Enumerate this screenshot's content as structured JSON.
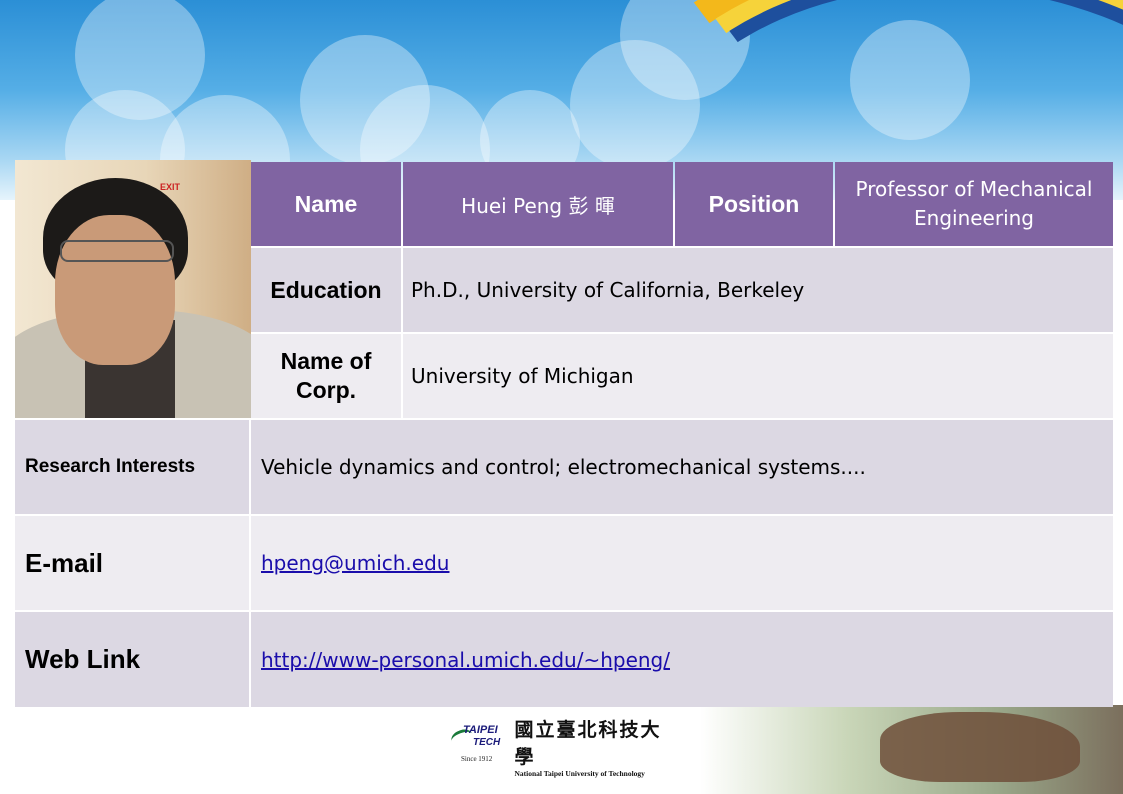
{
  "profile": {
    "name_label": "Name",
    "name_value": "Huei Peng 彭 暉",
    "position_label": "Position",
    "position_value": "Professor of Mechanical Engineering",
    "education_label": "Education",
    "education_value": "Ph.D., University of California, Berkeley",
    "corp_label": "Name of Corp.",
    "corp_value": "University of Michigan",
    "research_label": "Research Interests",
    "research_value": "Vehicle dynamics and control; electromechanical systems....",
    "email_label": "E-mail",
    "email_value": "hpeng@umich.edu",
    "weblink_label": "Web Link",
    "weblink_value": "http://www-personal.umich.edu/~hpeng/"
  },
  "photo": {
    "exit_sign": "EXIT"
  },
  "logo": {
    "taipei": "TAIPEI",
    "tech": "TECH",
    "since": "Since 1912",
    "chinese_name": "國立臺北科技大學",
    "english_name": "National Taipei University of Technology"
  },
  "colors": {
    "header_purple": "#8064a2",
    "row_dark": "#dcd8e3",
    "row_light": "#eeecf1",
    "link": "#1a0dab"
  }
}
